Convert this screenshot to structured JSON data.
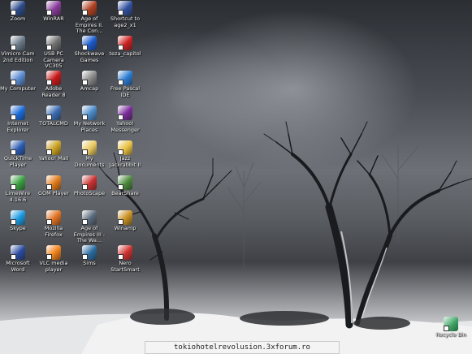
{
  "desktop": {
    "icons": [
      {
        "label": "Zoom",
        "icon": "zoom-icon",
        "color": "#2a4a8a"
      },
      {
        "label": "WinRAR",
        "icon": "winrar-icon",
        "color": "#8a3a9a"
      },
      {
        "label": "Age of Empires II. The Con...",
        "icon": "aoe2-icon",
        "color": "#b04020"
      },
      {
        "label": "Shortcut to age2_x1",
        "icon": "age2-shortcut-icon",
        "color": "#3050a0"
      },
      {
        "label": "Vimicro Cam 2nd Edition",
        "icon": "vimicro-icon",
        "color": "#6a7a8a"
      },
      {
        "label": "USB PC Camera VC305",
        "icon": "usb-camera-icon",
        "color": "#707070"
      },
      {
        "label": "Shockwave Games",
        "icon": "shockwave-icon",
        "color": "#1a5acc"
      },
      {
        "label": "teza_capitol",
        "icon": "pdf-file-icon",
        "color": "#cc2020"
      },
      {
        "label": "My Computer",
        "icon": "my-computer-icon",
        "color": "#5a8ad0"
      },
      {
        "label": "Adobe Reader 8",
        "icon": "adobe-reader-icon",
        "color": "#c81818"
      },
      {
        "label": "Amcap",
        "icon": "amcap-icon",
        "color": "#8a8a8a"
      },
      {
        "label": "Free Pascal IDE",
        "icon": "free-pascal-icon",
        "color": "#2a7ad0"
      },
      {
        "label": "Internet Explorer",
        "icon": "internet-explorer-icon",
        "color": "#1a6ad8"
      },
      {
        "label": "TOTALCMD",
        "icon": "totalcmd-icon",
        "color": "#3a6ab0"
      },
      {
        "label": "My Network Places",
        "icon": "network-places-icon",
        "color": "#4a8ac8"
      },
      {
        "label": "Yahoo! Messenger",
        "icon": "yahoo-messenger-icon",
        "color": "#7a2a9a"
      },
      {
        "label": "QuickTime Player",
        "icon": "quicktime-icon",
        "color": "#2a5ab0"
      },
      {
        "label": "Yahoo! Mail",
        "icon": "yahoo-mail-icon",
        "color": "#c8a020"
      },
      {
        "label": "My Documents",
        "icon": "my-documents-icon",
        "color": "#e8c860"
      },
      {
        "label": "Jazz Jackrabbit II",
        "icon": "folder-icon",
        "color": "#e8c040"
      },
      {
        "label": "LimeWire 4.16.6",
        "icon": "limewire-icon",
        "color": "#3aa040"
      },
      {
        "label": "GOM Player",
        "icon": "gom-player-icon",
        "color": "#e07818"
      },
      {
        "label": "PhotoScape",
        "icon": "photoscape-icon",
        "color": "#c83030"
      },
      {
        "label": "BearShare",
        "icon": "bearshare-icon",
        "color": "#4a8a3a"
      },
      {
        "label": "Skype",
        "icon": "skype-icon",
        "color": "#1a9ae0"
      },
      {
        "label": "Mozilla Firefox",
        "icon": "firefox-icon",
        "color": "#e07020"
      },
      {
        "label": "Age of Empires III - The Wa...",
        "icon": "aoe3-icon",
        "color": "#5a6a7a"
      },
      {
        "label": "Winamp",
        "icon": "winamp-icon",
        "color": "#c89020"
      },
      {
        "label": "Microsoft Word",
        "icon": "word-icon",
        "color": "#2a4aa0"
      },
      {
        "label": "VLC media player",
        "icon": "vlc-icon",
        "color": "#f08018"
      },
      {
        "label": "Sims",
        "icon": "sims-icon",
        "color": "#2a6aa0"
      },
      {
        "label": "Nero StartSmart",
        "icon": "nero-icon",
        "color": "#d03030"
      }
    ],
    "recycle_bin": {
      "label": "Recycle Bin",
      "icon": "recycle-bin-icon",
      "color": "#3aa060"
    }
  },
  "watermark": {
    "text": "tokiohotelrevolusion.3xforum.ro"
  }
}
